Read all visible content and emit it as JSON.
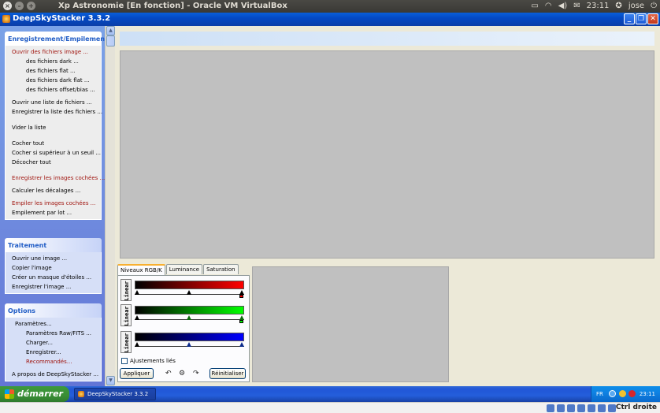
{
  "host": {
    "vm_title": "Xp Astronomie [En fonction] - Oracle VM VirtualBox",
    "time": "23:11",
    "user": "jose",
    "host_key": "Ctrl droite"
  },
  "app": {
    "title": "DeepSkyStacker 3.3.2"
  },
  "sidebar": {
    "groups": [
      {
        "title": "Enregistrement/Empilement",
        "items": [
          "Ouvrir des fichiers image ...",
          "des fichiers dark ...",
          "des fichiers flat ...",
          "des fichiers dark flat ...",
          "des fichiers offset/bias ...",
          "Ouvrir une liste de fichiers ...",
          "Enregistrer la liste des fichiers ...",
          "Vider la liste",
          "Cocher tout",
          "Cocher si supérieur à un seuil ...",
          "Décocher tout",
          "Enregistrer les images cochées ...",
          "Calculer les décalages ...",
          "Empiler les images cochées ...",
          "Empilement par lot ..."
        ]
      },
      {
        "title": "Traitement",
        "items": [
          "Ouvrir une image ...",
          "Copier l'image",
          "Créer un masque d'étoiles ...",
          "Enregistrer l'image ..."
        ]
      },
      {
        "title": "Options",
        "items": [
          "Paramètres...",
          "Paramètres Raw/FITS ...",
          "Charger...",
          "Enregistrer...",
          "Recommandés...",
          "A propos de DeepSkyStacker ..."
        ]
      }
    ]
  },
  "levels": {
    "tabs": [
      "Niveaux RGB/K",
      "Luminance",
      "Saturation"
    ],
    "mode_label": "Linear",
    "linked_label": "Ajustements liés",
    "apply_label": "Appliquer",
    "reset_label": "Réinitialiser",
    "colors": {
      "red": "#ff0000",
      "green": "#00ff00",
      "blue": "#0000ff"
    }
  },
  "taskbar": {
    "start_label": "démarrer",
    "task_label": "DeepSkyStacker 3.3.2",
    "lang": "FR",
    "time": "23:11"
  }
}
